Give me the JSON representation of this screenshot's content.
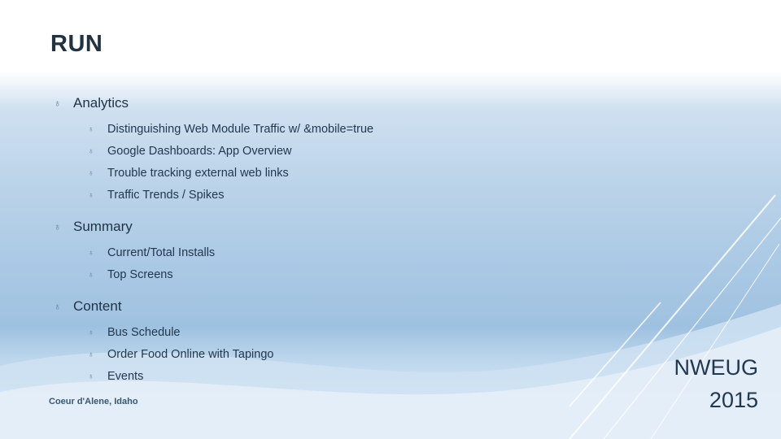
{
  "slide": {
    "title": "RUN",
    "footer_location": "Coeur d'Alene, Idaho",
    "brand_line1": "NWEUG",
    "brand_line2": "2015",
    "accent_color": "#9dc0e0",
    "text_color": "#1f3247",
    "bullet_glyph": "♁"
  },
  "sections": [
    {
      "heading": "Analytics",
      "items": [
        "Distinguishing Web Module Traffic w/ &mobile=true",
        "Google Dashboards: App Overview",
        "Trouble tracking external web links",
        "Traffic Trends / Spikes"
      ]
    },
    {
      "heading": "Summary",
      "items": [
        "Current/Total Installs",
        "Top Screens"
      ]
    },
    {
      "heading": "Content",
      "items": [
        "Bus Schedule",
        "Order Food Online with Tapingo",
        "Events"
      ]
    }
  ]
}
